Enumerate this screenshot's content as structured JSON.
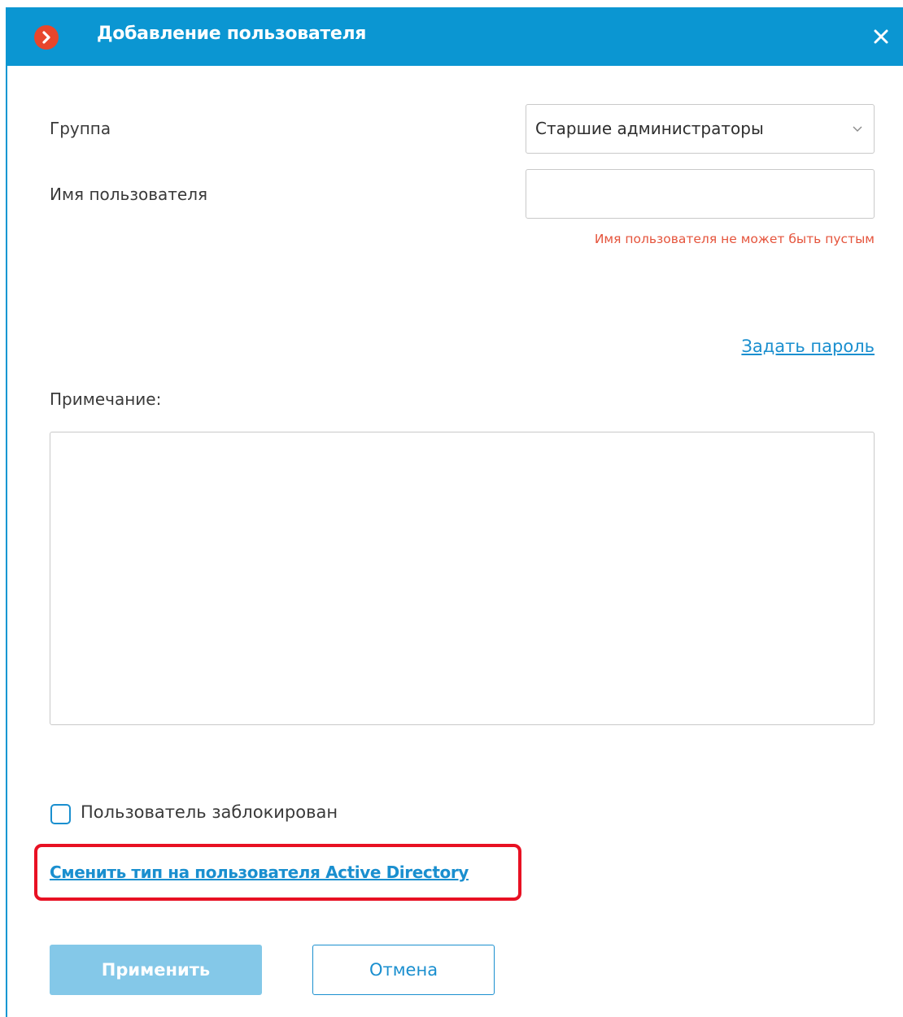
{
  "window": {
    "title": "Добавление пользователя",
    "logo_icon": "app-logo-icon",
    "close_icon": "close-icon",
    "accent_color": "#0b96d2"
  },
  "form": {
    "group_label": "Группа",
    "group_value": "Старшие администраторы",
    "username_label": "Имя пользователя",
    "username_value": "",
    "username_error": "Имя пользователя не может быть пустым",
    "set_password_link": "Задать пароль",
    "note_label": "Примечание:",
    "note_value": "",
    "blocked_label": "Пользователь заблокирован",
    "blocked_checked": false,
    "change_type_link": "Сменить тип на пользователя Active Directory"
  },
  "buttons": {
    "apply": "Применить",
    "cancel": "Отмена"
  },
  "colors": {
    "error": "#e5543c",
    "link": "#1a8fcf",
    "highlight": "#e81123",
    "apply_disabled": "#84c8e8"
  }
}
